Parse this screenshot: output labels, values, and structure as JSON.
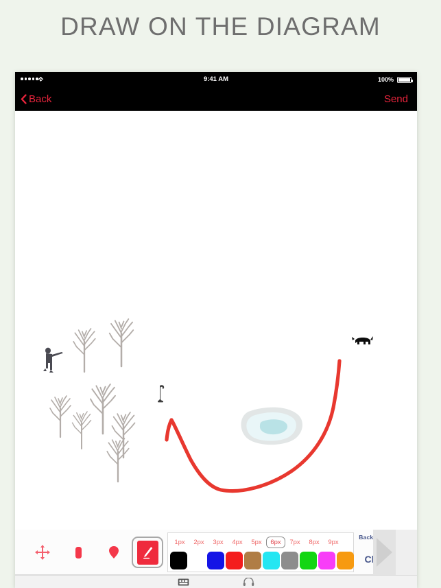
{
  "page": {
    "title": "DRAW ON THE DIAGRAM",
    "background_color": "#eff4ec",
    "title_color": "#6e6e6e"
  },
  "status_bar": {
    "signal_dots": 5,
    "wifi_icon": "wifi-icon",
    "time": "9:41 AM",
    "battery_percent": "100%",
    "battery_icon": "battery-full-icon"
  },
  "nav_bar": {
    "back_label": "Back",
    "back_icon": "chevron-left-icon",
    "send_label": "Send",
    "accent_color": "#e8243c",
    "background_color": "#000000"
  },
  "canvas": {
    "background_color": "#ffffff",
    "annotation": {
      "stroke_color": "#e8382f",
      "stroke_width": 6,
      "description": "hand-drawn red curve"
    },
    "map_objects": [
      {
        "name": "hunter-figure",
        "label": "Hunter with rifle",
        "color": "#4a4a52"
      },
      {
        "name": "bare-tree",
        "label": "Bare tree",
        "color": "#b0aaa6"
      },
      {
        "name": "pond",
        "label": "Pond",
        "fill": "#d8f0f2",
        "outline": "#d8dada"
      },
      {
        "name": "dog-figure",
        "label": "Dog",
        "color": "#111111"
      },
      {
        "name": "stump-marker",
        "label": "Stump",
        "color": "#3f3f3f"
      }
    ]
  },
  "toolbar": {
    "tools": [
      {
        "name": "move-tool",
        "icon": "move-arrows-icon",
        "label": "Move",
        "selected": false
      },
      {
        "name": "marker-tool",
        "icon": "marker-icon",
        "label": "Marker",
        "selected": false
      },
      {
        "name": "pin-tool",
        "icon": "map-pin-icon",
        "label": "Pin",
        "selected": false
      },
      {
        "name": "pencil-tool",
        "icon": "pencil-icon",
        "label": "Pencil",
        "selected": true
      }
    ],
    "stroke_sizes": [
      {
        "label": "1px",
        "selected": false
      },
      {
        "label": "2px",
        "selected": false
      },
      {
        "label": "3px",
        "selected": false
      },
      {
        "label": "4px",
        "selected": false
      },
      {
        "label": "5px",
        "selected": false
      },
      {
        "label": "6px",
        "selected": true
      },
      {
        "label": "7px",
        "selected": false
      },
      {
        "label": "8px",
        "selected": false
      },
      {
        "label": "9px",
        "selected": false
      }
    ],
    "selected_size": "6px",
    "colors": [
      {
        "name": "black",
        "hex": "#000000",
        "selected": false
      },
      {
        "name": "white",
        "hex": "#ffffff",
        "selected": false
      },
      {
        "name": "blue",
        "hex": "#1414e6",
        "selected": false
      },
      {
        "name": "red",
        "hex": "#f41c1c",
        "selected": true
      },
      {
        "name": "brown",
        "hex": "#b07d45",
        "selected": false
      },
      {
        "name": "cyan",
        "hex": "#25e6f2",
        "selected": false
      },
      {
        "name": "gray",
        "hex": "#8d8d8d",
        "selected": false
      },
      {
        "name": "green",
        "hex": "#13d613",
        "selected": false
      },
      {
        "name": "magenta",
        "hex": "#f83df8",
        "selected": false
      },
      {
        "name": "orange",
        "hex": "#f79a10",
        "selected": false
      }
    ],
    "background_label": "Background",
    "clear_label": "Clear",
    "next_icon": "triangle-right-icon",
    "link_color": "#46558a"
  },
  "tab_bar": {
    "items": [
      {
        "name": "keyboard-tab",
        "icon": "keyboard-icon"
      },
      {
        "name": "headset-tab",
        "icon": "headset-icon"
      }
    ]
  }
}
